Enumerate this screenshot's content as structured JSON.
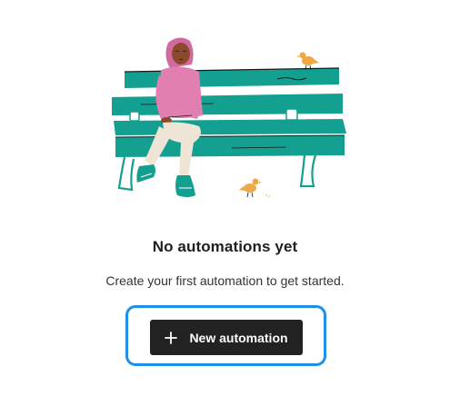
{
  "empty_state": {
    "title": "No automations yet",
    "description": "Create your first automation to get started.",
    "illustration": "person-sitting-on-park-bench-with-birds"
  },
  "actions": {
    "new_automation_label": "New automation",
    "new_automation_icon": "plus-icon"
  },
  "colors": {
    "bench": "#14a090",
    "button_bg": "#222222",
    "focus_ring": "#1e90ea",
    "hoodie": "#e07fb0",
    "bird": "#eea848"
  }
}
